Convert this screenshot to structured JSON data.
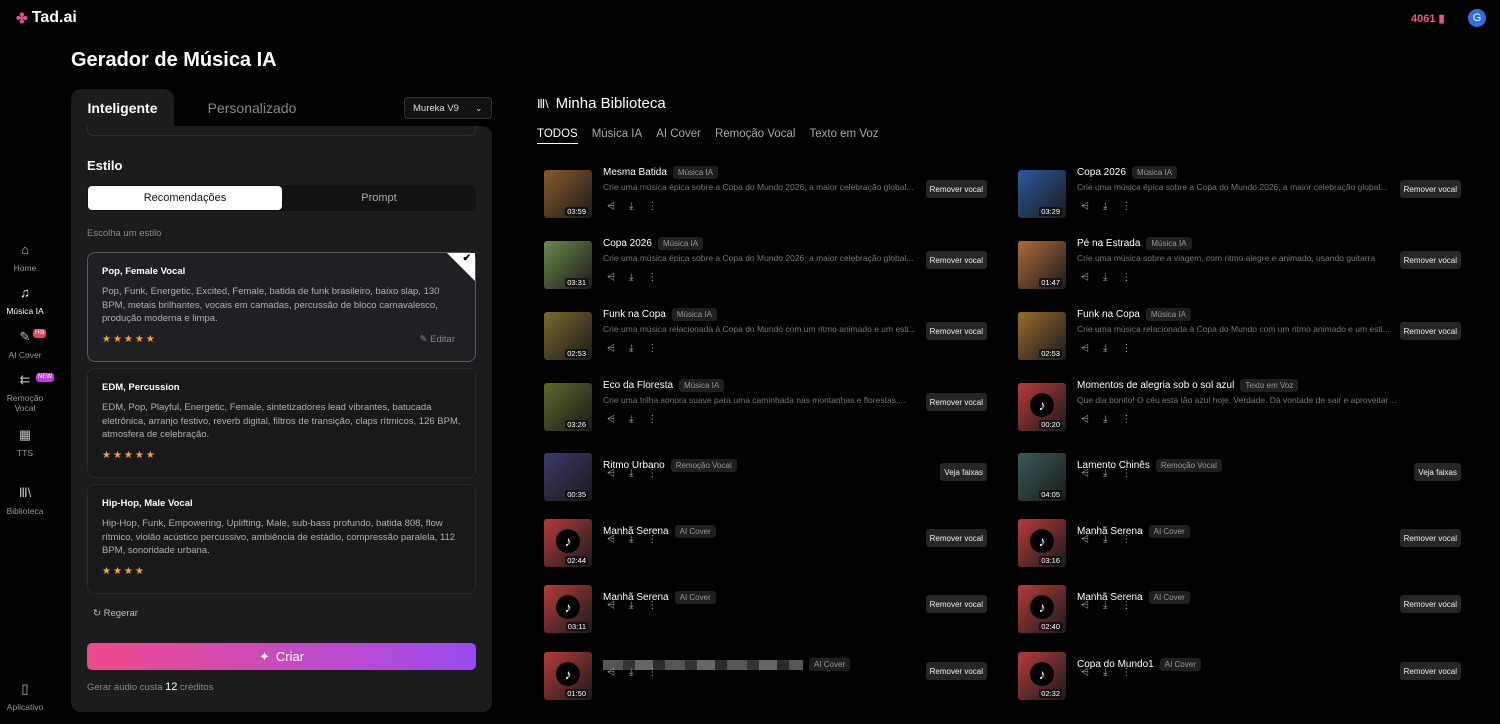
{
  "brand": {
    "name": "Tad.ai"
  },
  "header": {
    "credits": "4061",
    "avatar_letter": "G"
  },
  "sidebar": {
    "items": [
      {
        "label": "Home",
        "icon": "home-icon"
      },
      {
        "label": "Música IA",
        "icon": "music-note-icon"
      },
      {
        "label": "AI Cover",
        "icon": "microphone-icon",
        "badge": "Hot"
      },
      {
        "label": "Remoção Vocal",
        "icon": "vocal-removal-icon",
        "badge": "NEW"
      },
      {
        "label": "TTS",
        "icon": "tts-icon"
      },
      {
        "label": "Biblioteca",
        "icon": "library-icon"
      },
      {
        "label": "Aplicativo",
        "icon": "phone-icon"
      }
    ]
  },
  "page": {
    "title": "Gerador de Música IA"
  },
  "generator": {
    "tabs": [
      "Inteligente",
      "Personalizado"
    ],
    "model": "Mureka V9",
    "style_heading": "Estilo",
    "segments": [
      "Recomendações",
      "Prompt"
    ],
    "choose_label": "Escolha um estilo",
    "cards": [
      {
        "title": "Pop, Female Vocal",
        "desc": "Pop, Funk, Energetic, Excited, Female, batida de funk brasileiro, baixo slap, 130 BPM, metais brilhantes, vocais em camadas, percussão de bloco carnavalesco, produção moderna e limpa.",
        "rating": 5,
        "edit": "Editar",
        "stars": "★★★★★"
      },
      {
        "title": "EDM, Percussion",
        "desc": "EDM, Pop, Playful, Energetic, Female, sintetizadores lead vibrantes, batucada eletrônica, arranjo festivo, reverb digital, filtros de transição, claps rítmicos, 126 BPM, atmosfera de celebração.",
        "rating": 5,
        "stars": "★★★★★"
      },
      {
        "title": "Hip-Hop, Male Vocal",
        "desc": "Hip-Hop, Funk, Empowering, Uplifting, Male, sub-bass profundo, batida 808, flow rítmico, violão acústico percussivo, ambiência de estádio, compressão paralela, 112 BPM, sonoridade urbana.",
        "rating": 4,
        "stars": "★★★★"
      }
    ],
    "regen": "Regerar",
    "create": "Criar",
    "cost_prefix": "Gerar áudio custa",
    "cost_value": "12",
    "cost_suffix": "créditos"
  },
  "library": {
    "title": "Minha Biblioteca",
    "tabs": [
      "TODOS",
      "Música IA",
      "AI Cover",
      "Remoção Vocal",
      "Texto em Voz"
    ],
    "items": [
      {
        "name": "Mesma Batida",
        "tag": "Música IA",
        "desc": "Crie uma música épica sobre a Copa do Mundo 2026, a maior celebração global...",
        "dur": "03:59",
        "button": "Remover vocal",
        "thumb_color": "#8a5a2a"
      },
      {
        "name": "Copa 2026",
        "tag": "Música IA",
        "desc": "Crie uma música épica sobre a Copa do Mundo 2026, a maior celebração global...",
        "dur": "03:29",
        "button": "Remover vocal",
        "thumb_color": "#2a5aa0"
      },
      {
        "name": "Copa 2026",
        "tag": "Música IA",
        "desc": "Crie uma música épica sobre a Copa do Mundo 2026: a maior celebração global...",
        "dur": "03:31",
        "button": "Remover vocal",
        "thumb_color": "#6a8a4a"
      },
      {
        "name": "Pé na Estrada",
        "tag": "Música IA",
        "desc": "Crie uma música sobre a viagem, com ritmo alegre e animado, usando guitarra",
        "dur": "01:47",
        "button": "Remover vocal",
        "thumb_color": "#b06a3a"
      },
      {
        "name": "Funk na Copa",
        "tag": "Música IA",
        "desc": "Crie uma música relacionada à Copa do Mundo com um ritmo animado e um esti...",
        "dur": "02:53",
        "button": "Remover vocal",
        "thumb_color": "#7a6a2a"
      },
      {
        "name": "Funk na Copa",
        "tag": "Música IA",
        "desc": "Crie uma música relacionada à Copa do Mundo com um ritmo animado e um esti...",
        "dur": "02:53",
        "button": "Remover vocal",
        "thumb_color": "#9a6a2a"
      },
      {
        "name": "Eco da Floresta",
        "tag": "Música IA",
        "desc": "Crie uma trilha sonora suave para uma caminhada nas montanhas e florestas,...",
        "dur": "03:26",
        "button": "Remover vocal",
        "thumb_color": "#5a6a2a"
      },
      {
        "name": "Momentos de alegria sob o sol azul",
        "tag": "Texto em Voz",
        "desc": "Que dia bonito! O céu está tão azul hoje. Verdade. Dá vontade de sair e aproveitar o sol. Às veze...",
        "dur": "00:20",
        "button": "",
        "thumb_color": "#b83a3a",
        "note": true
      },
      {
        "name": "Ritmo Urbano",
        "tag": "Remoção Vocal",
        "desc": "",
        "dur": "00:35",
        "button": "Veja faixas",
        "thumb_color": "#3a3a6a"
      },
      {
        "name": "Lamento Chinês",
        "tag": "Remoção Vocal",
        "desc": "",
        "dur": "04:05",
        "button": "Veja faixas",
        "thumb_color": "#3a5a5a"
      },
      {
        "name": "Manhã Serena",
        "tag": "AI Cover",
        "desc": "",
        "dur": "02:44",
        "button": "Remover vocal",
        "thumb_color": "#b83a3a",
        "note": true
      },
      {
        "name": "Manhã Serena",
        "tag": "AI Cover",
        "desc": "",
        "dur": "03:16",
        "button": "Remover vocal",
        "thumb_color": "#b83a3a",
        "note": true
      },
      {
        "name": "Manhã Serena",
        "tag": "AI Cover",
        "desc": "",
        "dur": "03:11",
        "button": "Remover vocal",
        "thumb_color": "#b83a3a",
        "note": true
      },
      {
        "name": "Manhã Serena",
        "tag": "AI Cover",
        "desc": "",
        "dur": "02:40",
        "button": "Remover vocal",
        "thumb_color": "#b83a3a",
        "note": true
      },
      {
        "name": "",
        "tag": "AI Cover",
        "desc": "",
        "dur": "01:50",
        "button": "Remover vocal",
        "thumb_color": "#b83a3a",
        "note": true,
        "blurred": true
      },
      {
        "name": "Copa do Mundo1",
        "tag": "AI Cover",
        "desc": "",
        "dur": "02:32",
        "button": "Remover vocal",
        "thumb_color": "#b83a3a",
        "note": true
      }
    ]
  }
}
